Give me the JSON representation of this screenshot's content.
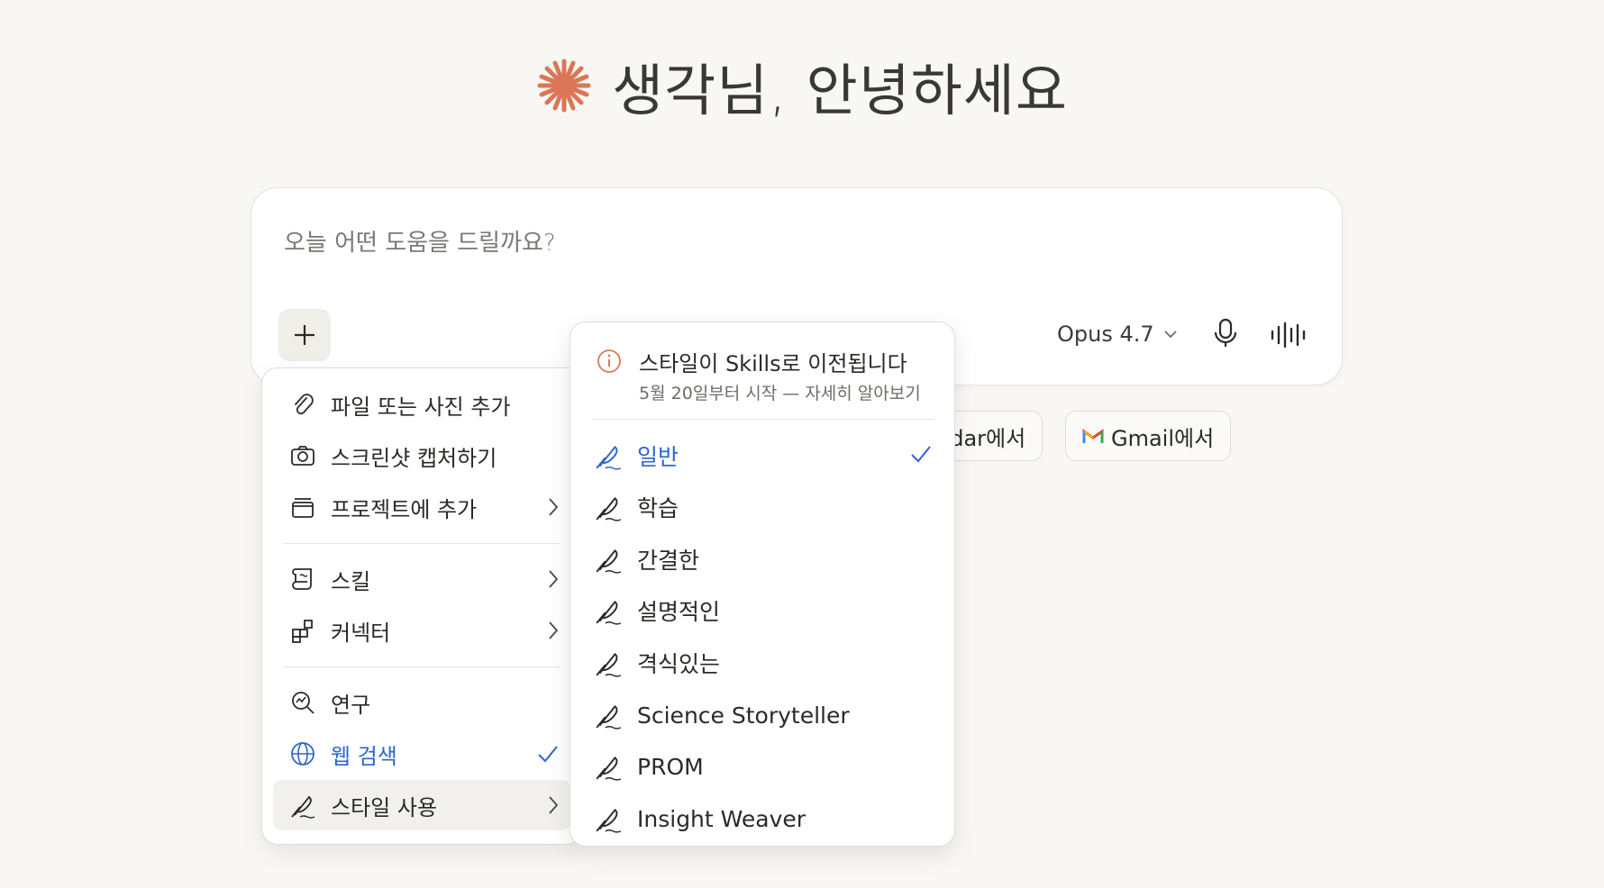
{
  "greeting": {
    "title": "생각님, 안녕하세요"
  },
  "composer": {
    "placeholder": "오늘 어떤 도움을 드릴까요?",
    "model": "Opus 4.7"
  },
  "chips": [
    {
      "label": "ndar에서"
    },
    {
      "label": "Gmail에서"
    }
  ],
  "attach_menu": {
    "items": [
      {
        "label": "파일 또는 사진 추가",
        "icon": "paperclip-icon"
      },
      {
        "label": "스크린샷 캡처하기",
        "icon": "camera-icon"
      },
      {
        "label": "프로젝트에 추가",
        "icon": "project-icon"
      },
      {
        "label": "스킬",
        "icon": "scroll-icon"
      },
      {
        "label": "커넥터",
        "icon": "connector-icon"
      },
      {
        "label": "연구",
        "icon": "research-icon"
      },
      {
        "label": "웹 검색",
        "icon": "globe-icon",
        "checked": true
      },
      {
        "label": "스타일 사용",
        "icon": "feather-icon"
      }
    ]
  },
  "style_menu": {
    "notice_title": "스타일이 Skills로 이전됩니다",
    "notice_sub": "5월 20일부터 시작 — 자세히 알아보기",
    "items": [
      {
        "label": "일반",
        "selected": true
      },
      {
        "label": "학습"
      },
      {
        "label": "간결한"
      },
      {
        "label": "설명적인"
      },
      {
        "label": "격식있는"
      },
      {
        "label": "Science Storyteller"
      },
      {
        "label": "PROM"
      },
      {
        "label": "Insight Weaver"
      }
    ]
  },
  "colors": {
    "accent": "#d97757",
    "selected_blue": "#2c66c9",
    "background": "#f8f7f4"
  }
}
